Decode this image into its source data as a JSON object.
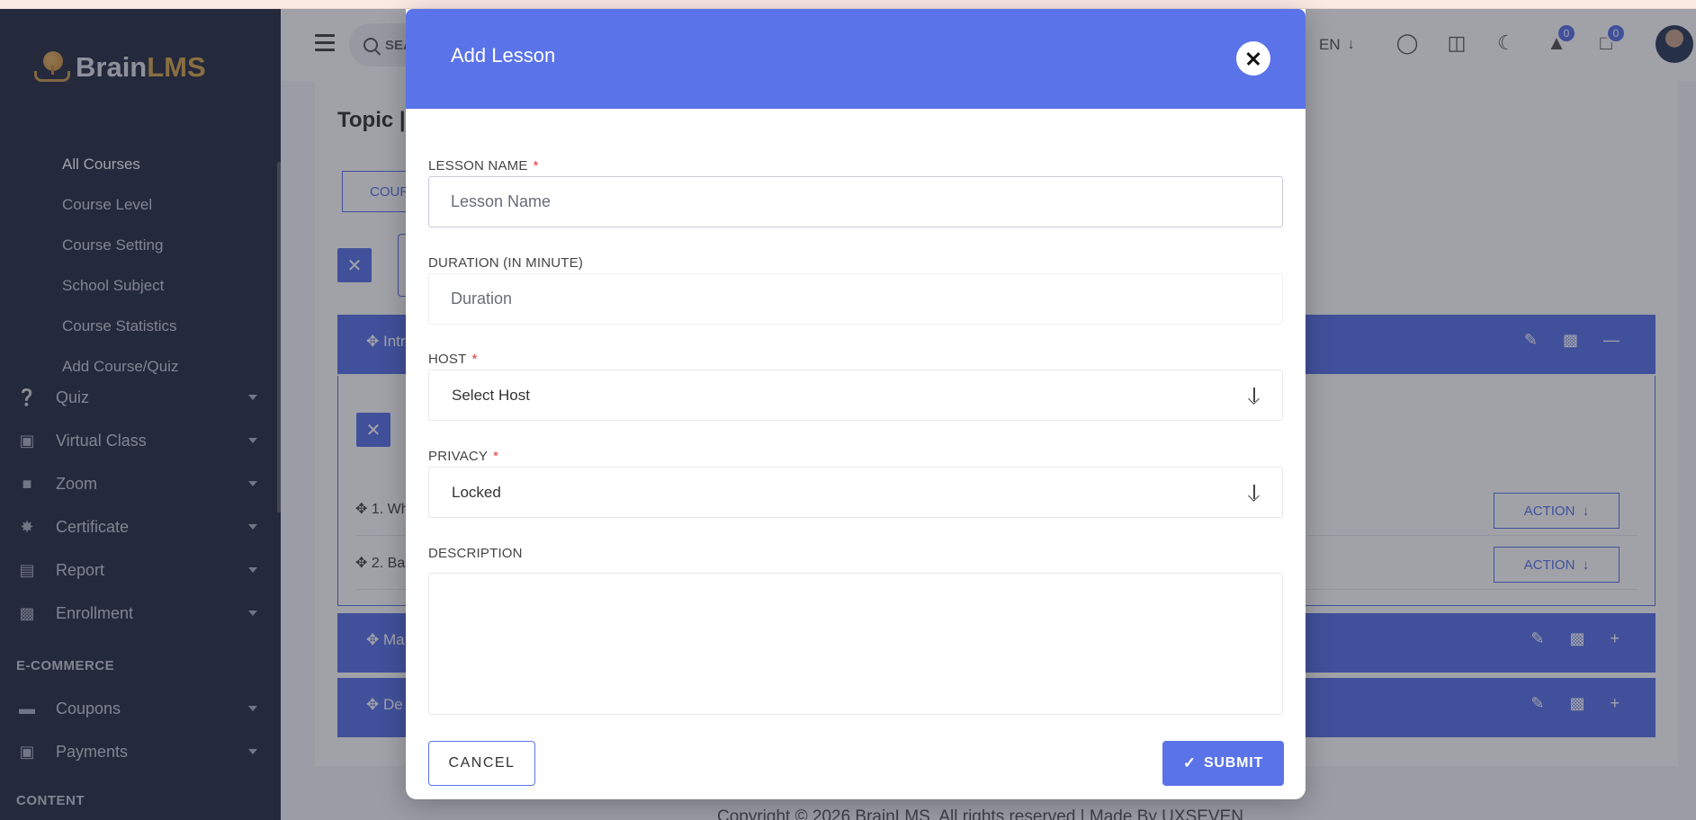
{
  "brand": {
    "name_part1": "Brain",
    "name_part2": "LMS"
  },
  "sidebar": {
    "sub_items": [
      {
        "label": "All Courses"
      },
      {
        "label": "Course Level"
      },
      {
        "label": "Course Setting"
      },
      {
        "label": "School Subject"
      },
      {
        "label": "Course Statistics"
      },
      {
        "label": "Add Course/Quiz"
      }
    ],
    "items": [
      {
        "label": "Quiz",
        "icon": "question-circle-icon"
      },
      {
        "label": "Virtual Class",
        "icon": "vr-headset-icon"
      },
      {
        "label": "Zoom",
        "icon": "video-camera-icon"
      },
      {
        "label": "Certificate",
        "icon": "certificate-badge-icon"
      },
      {
        "label": "Report",
        "icon": "area-chart-icon"
      },
      {
        "label": "Enrollment",
        "icon": "enrollment-icon"
      }
    ],
    "section_ecommerce": "E-COMMERCE",
    "ecommerce_items": [
      {
        "label": "Coupons",
        "icon": "ticket-icon"
      },
      {
        "label": "Payments",
        "icon": "money-bill-icon"
      }
    ],
    "section_content": "CONTENT"
  },
  "header": {
    "search_text": "SEA",
    "language": "EN",
    "notification_count": "0",
    "message_count": "0"
  },
  "background": {
    "topic_title": "Topic |",
    "tab_label": "COUR",
    "chapters": [
      {
        "label": "Intr"
      },
      {
        "label": "Ma"
      },
      {
        "label": "De"
      }
    ],
    "lessons": [
      {
        "label": "1. Wh",
        "action": "ACTION"
      },
      {
        "label": "2. Ba",
        "action": "ACTION"
      }
    ],
    "copyright": "Copyright © 2026 BrainLMS. All rights reserved | Made By UXSEVEN"
  },
  "modal": {
    "title": "Add Lesson",
    "fields": {
      "lesson_name": {
        "label": "LESSON NAME",
        "placeholder": "Lesson Name",
        "value": ""
      },
      "duration": {
        "label": "DURATION (IN MINUTE)",
        "placeholder": "Duration",
        "value": ""
      },
      "host": {
        "label": "HOST",
        "selected": "Select Host"
      },
      "privacy": {
        "label": "PRIVACY",
        "selected": "Locked"
      },
      "description": {
        "label": "DESCRIPTION",
        "value": ""
      }
    },
    "required_mark": "*",
    "cancel_label": "CANCEL",
    "submit_label": "SUBMIT"
  },
  "colors": {
    "accent": "#5b73e8",
    "sidebar_bg": "#2a2f45",
    "required": "#e53935"
  }
}
